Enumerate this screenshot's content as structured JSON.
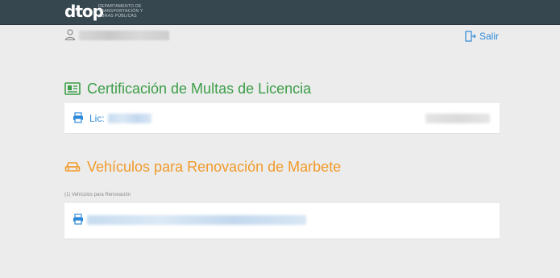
{
  "header": {
    "logo_text": "dtop",
    "logo_subtitle": "Departamento de Transportación y Obras Públicas"
  },
  "user": {
    "name": "████████████",
    "logout_label": "Salir"
  },
  "sections": {
    "fines": {
      "title": "Certificación de Multas de Licencia",
      "license_label": "Lic:",
      "license_value": "████████",
      "right_value": "████████"
    },
    "vehicles": {
      "title": "Vehículos para Renovación de Marbete",
      "count_note": "(1) Vehículos para Renovación",
      "vehicle_value": "████████████████████████"
    }
  },
  "colors": {
    "topbar": "#37474f",
    "green": "#3c9e48",
    "orange": "#f19a2a",
    "link": "#2e8ad8",
    "background": "#ececec"
  },
  "icons": {
    "user": "user-icon",
    "logout": "logout-icon",
    "license": "license-card-icon",
    "car": "car-icon",
    "print": "printer-icon"
  }
}
